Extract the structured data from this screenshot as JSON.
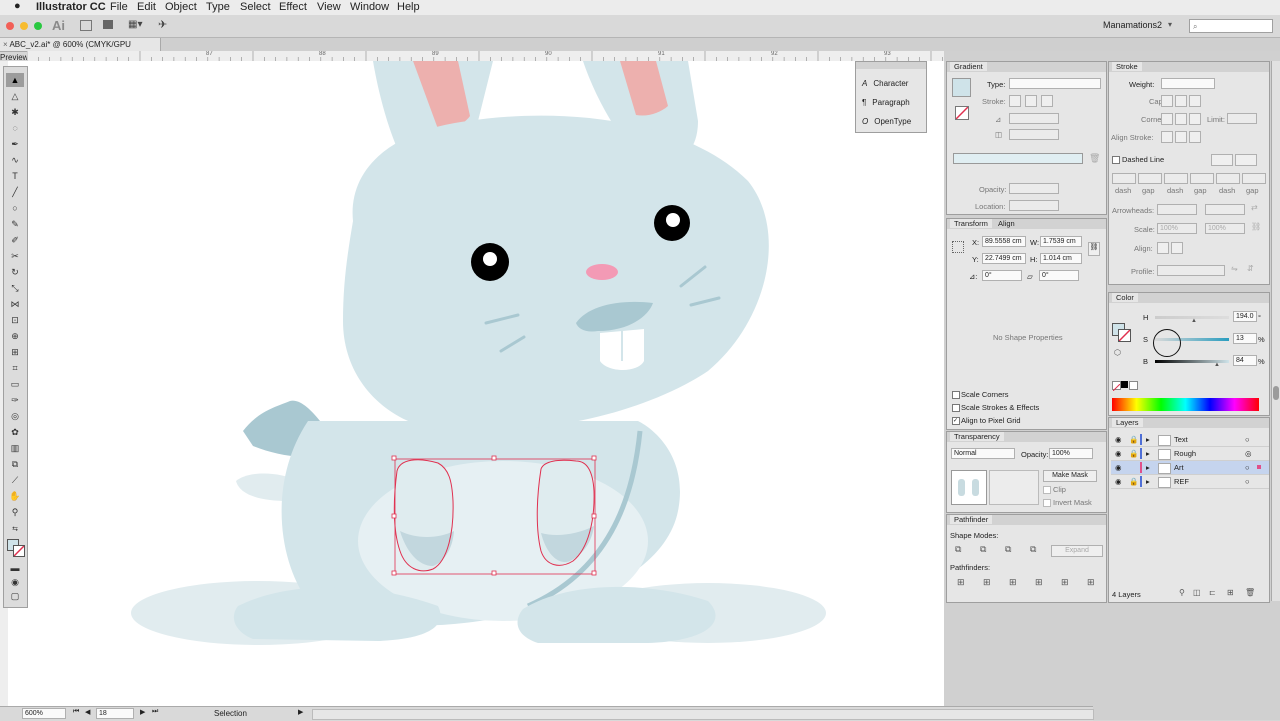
{
  "menubar": {
    "apple": "",
    "app_name": "Illustrator CC",
    "items": [
      "File",
      "Edit",
      "Object",
      "Type",
      "Select",
      "Effect",
      "View",
      "Window",
      "Help"
    ]
  },
  "appbar": {
    "ai_logo": "Ai",
    "workspace": "Manamations2",
    "search_placeholder": ""
  },
  "document": {
    "tab_title": "ABC_v2.ai* @ 600% (CMYK/GPU Preview)"
  },
  "ruler": {
    "h_ticks": [
      "87",
      "88",
      "89",
      "90",
      "91",
      "92",
      "93"
    ]
  },
  "floating_type_panel": {
    "items": [
      "Character",
      "Paragraph",
      "OpenType"
    ]
  },
  "gradient_panel": {
    "title": "Gradient",
    "type_label": "Type:",
    "stroke_label": "Stroke:",
    "opacity_label": "Opacity:",
    "location_label": "Location:"
  },
  "transform_panel": {
    "tabs": [
      "Transform",
      "Align"
    ],
    "x_label": "X:",
    "x_value": "89.5558 cm",
    "y_label": "Y:",
    "y_value": "22.7499 cm",
    "w_label": "W:",
    "w_value": "1.7539 cm",
    "h_label": "H:",
    "h_value": "1.014 cm",
    "angle_label": "⊿:",
    "angle_value": "0°",
    "shear_value": "0°",
    "no_shape": "No Shape Properties",
    "options": [
      {
        "label": "Scale Corners",
        "checked": false
      },
      {
        "label": "Scale Strokes & Effects",
        "checked": false
      },
      {
        "label": "Align to Pixel Grid",
        "checked": true
      }
    ]
  },
  "transparency_panel": {
    "title": "Transparency",
    "mode": "Normal",
    "opacity_label": "Opacity:",
    "opacity_value": "100%",
    "make_mask": "Make Mask",
    "clip": "Clip",
    "invert_mask": "Invert Mask"
  },
  "pathfinder_panel": {
    "title": "Pathfinder",
    "shape_modes": "Shape Modes:",
    "expand": "Expand",
    "pathfinders": "Pathfinders:"
  },
  "stroke_panel": {
    "title": "Stroke",
    "weight_label": "Weight:",
    "cap_label": "Cap:",
    "corner_label": "Corner:",
    "limit_label": "Limit:",
    "align_label": "Align Stroke:",
    "dashed_line": "Dashed Line",
    "dash_labels": [
      "dash",
      "gap",
      "dash",
      "gap",
      "dash",
      "gap"
    ],
    "arrowheads_label": "Arrowheads:",
    "scale_label": "Scale:",
    "scale_value1": "100%",
    "scale_value2": "100%",
    "align2_label": "Align:",
    "profile_label": "Profile:"
  },
  "color_panel": {
    "title": "Color",
    "h_label": "H",
    "h_value": "194.0",
    "h_unit": "°",
    "s_label": "S",
    "s_value": "13",
    "s_unit": "%",
    "b_label": "B",
    "b_value": "84",
    "b_unit": "%",
    "swatch_color": "#cfe3e9"
  },
  "layers_panel": {
    "title": "Layers",
    "layers": [
      {
        "name": "Text",
        "color": "#4f6fd6",
        "selected": false
      },
      {
        "name": "Rough",
        "color": "#4f6fd6",
        "selected": false
      },
      {
        "name": "Art",
        "color": "#e0508a",
        "selected": true
      },
      {
        "name": "REF",
        "color": "#4f6fd6",
        "selected": false
      }
    ],
    "count": "4 Layers"
  },
  "status": {
    "zoom": "600%",
    "artboard": "18",
    "tool": "Selection"
  },
  "colors": {
    "bunny_body": "#d3e5ea",
    "bunny_shadow": "#a9c8d1",
    "ear_inner": "#edb0ae",
    "nose": "#f39ab5",
    "selection": "#e0304f"
  }
}
